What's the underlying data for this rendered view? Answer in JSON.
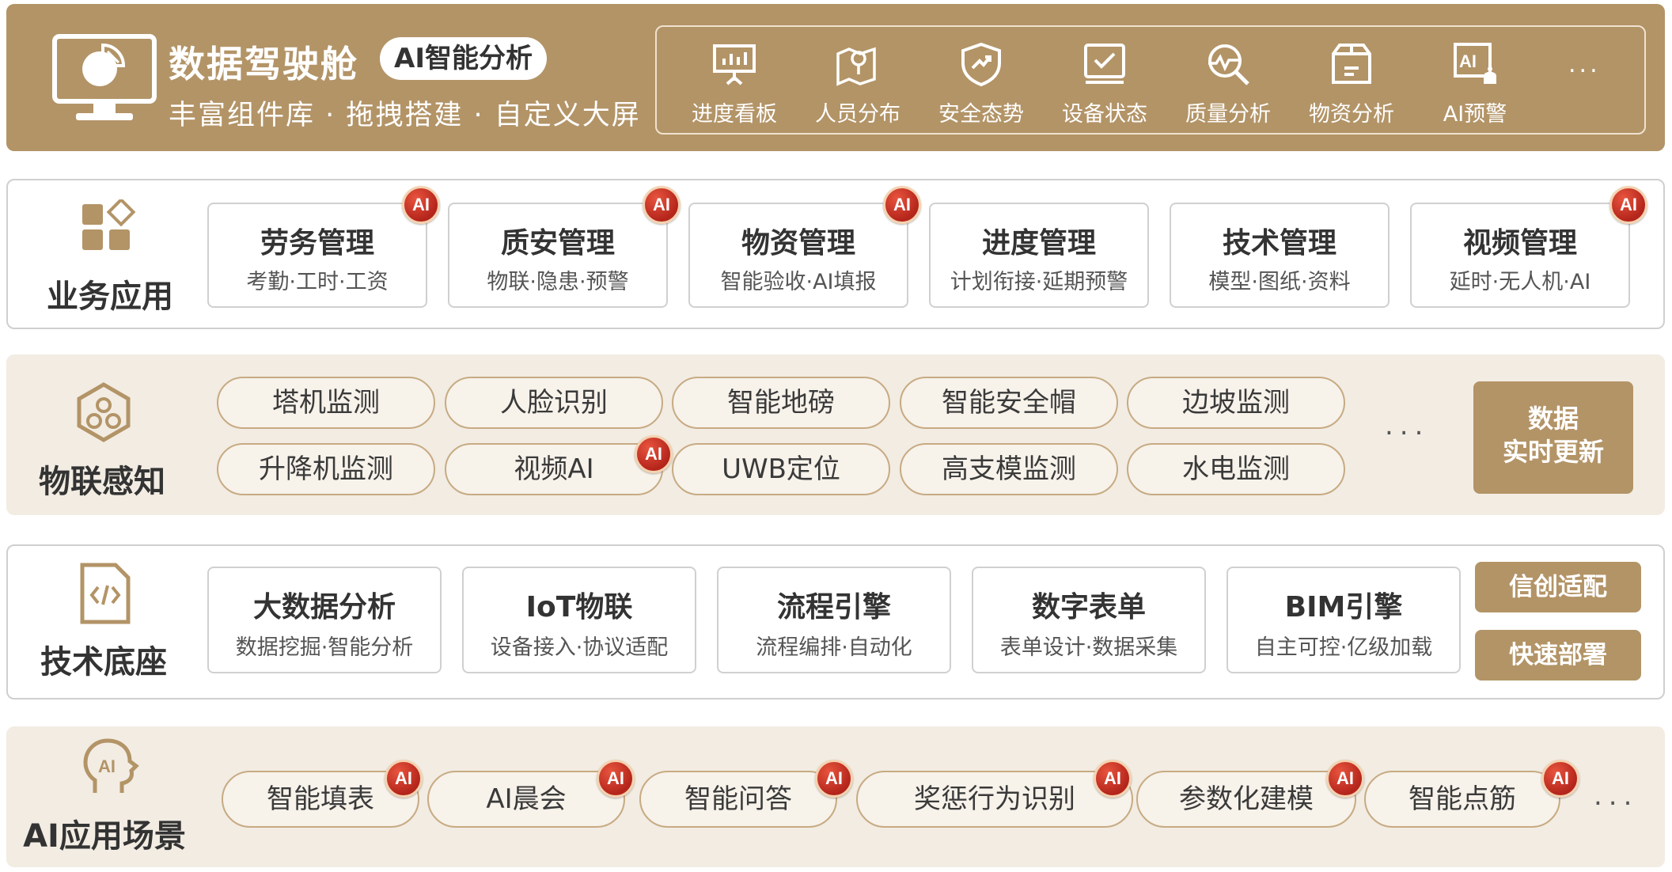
{
  "header": {
    "title": "数据驾驶舱",
    "badge": "AI智能分析",
    "subtitle": "丰富组件库 · 拖拽搭建 · 自定义大屏",
    "modules": [
      "进度看板",
      "人员分布",
      "安全态势",
      "设备状态",
      "质量分析",
      "物资分析",
      "AI预警"
    ],
    "more": "...",
    "colors": {
      "gold": "#b39467",
      "beige": "#f2ece3",
      "ai_red": "#c8321f"
    }
  },
  "business": {
    "title": "业务应用",
    "cards": [
      {
        "title": "劳务管理",
        "sub": "考勤·工时·工资",
        "ai": true
      },
      {
        "title": "质安管理",
        "sub": "物联·隐患·预警",
        "ai": true
      },
      {
        "title": "物资管理",
        "sub": "智能验收·AI填报",
        "ai": true
      },
      {
        "title": "进度管理",
        "sub": "计划衔接·延期预警",
        "ai": false
      },
      {
        "title": "技术管理",
        "sub": "模型·图纸·资料",
        "ai": false
      },
      {
        "title": "视频管理",
        "sub": "延时·无人机·AI",
        "ai": true
      }
    ],
    "ai_label": "AI"
  },
  "iot": {
    "title": "物联感知",
    "row1": [
      "塔机监测",
      "人脸识别",
      "智能地磅",
      "智能安全帽",
      "边坡监测"
    ],
    "row2": [
      "升降机监测",
      "视频AI",
      "UWB定位",
      "高支模监测",
      "水电监测"
    ],
    "more": "...",
    "realtime": [
      "数据",
      "实时更新"
    ]
  },
  "tech": {
    "title": "技术底座",
    "cards": [
      {
        "title": "大数据分析",
        "sub": "数据挖掘·智能分析"
      },
      {
        "title": "IoT物联",
        "sub": "设备接入·协议适配"
      },
      {
        "title": "流程引擎",
        "sub": "流程编排·自动化"
      },
      {
        "title": "数字表单",
        "sub": "表单设计·数据采集"
      },
      {
        "title": "BIM引擎",
        "sub": "自主可控·亿级加载"
      }
    ],
    "buttons": [
      "信创适配",
      "快速部署"
    ]
  },
  "ai_scenes": {
    "title": "AI应用场景",
    "items": [
      "智能填表",
      "AI晨会",
      "智能问答",
      "奖惩行为识别",
      "参数化建模",
      "智能点筋"
    ],
    "more": "..."
  }
}
